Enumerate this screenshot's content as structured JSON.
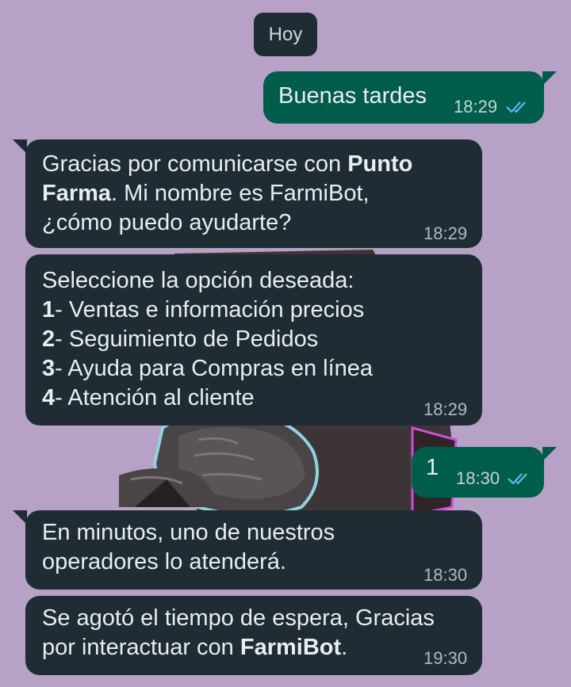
{
  "date_chip": "Hoy",
  "messages": [
    {
      "text": "Buenas tardes",
      "time": "18:29"
    },
    {
      "line1_a": "Gracias por comunicarse con ",
      "line1_b": "Punto",
      "line2_b": "Farma",
      "line2_a": ". Mi nombre es FarmiBot,",
      "line3": "¿cómo puedo ayudarte?",
      "time": "18:29"
    },
    {
      "line1": "Seleccione la opción deseada:",
      "options": [
        {
          "num": "1",
          "label": "- Ventas e información precios"
        },
        {
          "num": "2",
          "label": "- Seguimiento de Pedidos"
        },
        {
          "num": "3",
          "label": "- Ayuda para Compras en línea"
        },
        {
          "num": "4",
          "label": "- Atención al cliente"
        }
      ],
      "time": "18:29"
    },
    {
      "text": "1",
      "time": "18:30"
    },
    {
      "line1": "En minutos, uno de nuestros",
      "line2": "operadores lo atenderá.",
      "time": "18:30"
    },
    {
      "line1": "Se agotó el tiempo de espera, Gracias",
      "line2_a": "por interactuar con ",
      "line2_b": "FarmiBot",
      "line2_c": ".",
      "time": "19:30"
    }
  ],
  "icons": {
    "read_receipt": "double-check-icon"
  },
  "colors": {
    "background": "#b7a1c6",
    "incoming": "#1f2c34",
    "outgoing": "#005c4b",
    "read_tick": "#53bdeb"
  }
}
